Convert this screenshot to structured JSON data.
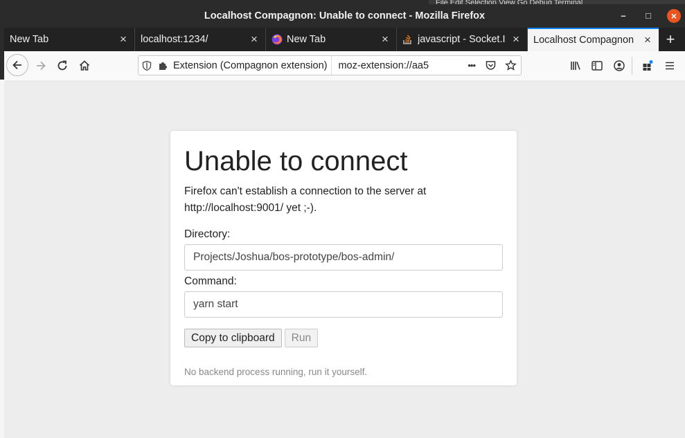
{
  "window": {
    "title": "Localhost Compagnon: Unable to connect - Mozilla Firefox",
    "controls": {
      "minimize": "–",
      "maximize": "□",
      "close": "×"
    }
  },
  "background_menu": "File   Edit   Selection   View   Go   Debug   Terminal",
  "tabs": [
    {
      "label": "New Tab",
      "icon": "none",
      "active": false
    },
    {
      "label": "localhost:1234/",
      "icon": "none",
      "active": false
    },
    {
      "label": "New Tab",
      "icon": "firefox-icon",
      "active": false
    },
    {
      "label": "javascript - Socket.I",
      "icon": "stackoverflow-icon",
      "active": false
    },
    {
      "label": "Localhost Compagnon",
      "icon": "none",
      "active": true
    }
  ],
  "newtab_label": "+",
  "tab_close_glyph": "×",
  "urlbar": {
    "identity_label": "Extension (Compagnon extension)",
    "url": "moz-extension://aa5",
    "overflow": "•••"
  },
  "page": {
    "heading": "Unable to connect",
    "description_line1": "Firefox can't establish a connection to the server at",
    "description_line2": "http://localhost:9001/ yet ;-).",
    "directory_label": "Directory:",
    "directory_value": "Projects/Joshua/bos-prototype/bos-admin/",
    "command_label": "Command:",
    "command_value": "yarn start",
    "copy_button": "Copy to clipboard",
    "run_button": "Run",
    "status": "No backend process running, run it yourself."
  },
  "colors": {
    "accent": "#0a84ff",
    "close_button": "#e95420",
    "titlebar": "#2b2b2b"
  }
}
